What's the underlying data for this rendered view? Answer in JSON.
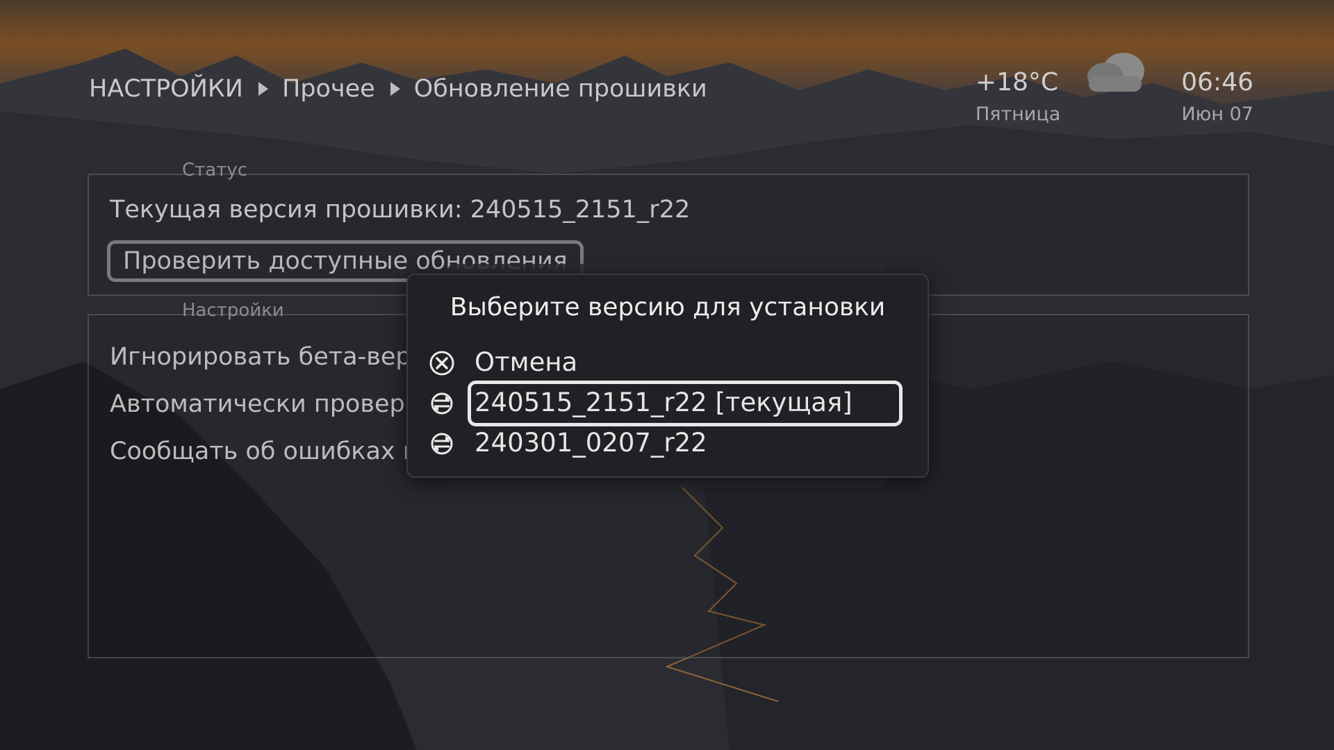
{
  "breadcrumb": {
    "items": [
      "НАСТРОЙКИ",
      "Прочее",
      "Обновление прошивки"
    ]
  },
  "weather": {
    "temperature": "+18°C",
    "day": "Пятница",
    "icon": "cloud-icon"
  },
  "clock": {
    "time": "06:46",
    "date": "Июн 07"
  },
  "status_group": {
    "title": "Статус",
    "current_version": "Текущая версия прошивки: 240515_2151_r22",
    "check_button": "Проверить доступные обновления"
  },
  "settings_group": {
    "title": "Настройки",
    "items": [
      "Игнорировать бета-вер",
      "Автоматически проверя",
      "Сообщать об ошибках п"
    ]
  },
  "dialog": {
    "title": "Выберите версию для установки",
    "options": [
      {
        "label": "Отмена",
        "icon": "cancel-icon"
      },
      {
        "label": "240515_2151_r22 [текущая]",
        "icon": "update-icon",
        "selected": true
      },
      {
        "label": "240301_0207_r22",
        "icon": "update-icon"
      }
    ]
  },
  "colors": {
    "accent": "#e8e8e8",
    "dialog_bg": "#202124"
  }
}
